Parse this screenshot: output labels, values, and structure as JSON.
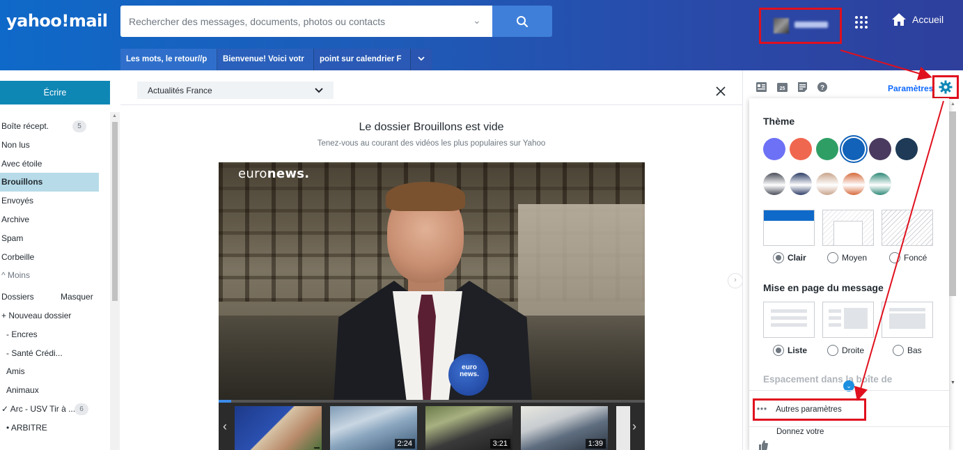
{
  "header": {
    "logo": "yahoo!mail",
    "search_placeholder": "Rechercher des messages, documents, photos ou contacts",
    "home_label": "Accueil"
  },
  "tabs": [
    {
      "label": "Les mots, le retour//p"
    },
    {
      "label": "Bienvenue! Voici votr"
    },
    {
      "label": "point sur calendrier F"
    }
  ],
  "sidebar": {
    "compose_label": "Écrire",
    "folders": [
      {
        "label": "Boîte récept.",
        "count": "5"
      },
      {
        "label": "Non lus"
      },
      {
        "label": "Avec étoile"
      },
      {
        "label": "Brouillons"
      },
      {
        "label": "Envoyés"
      },
      {
        "label": "Archive"
      },
      {
        "label": "Spam"
      },
      {
        "label": "Corbeille"
      },
      {
        "label": "^ Moins"
      }
    ],
    "folders_heading": "Dossiers",
    "hide_label": "Masquer",
    "new_folder_label": "+ Nouveau dossier",
    "user_folders": [
      {
        "label": "- Encres"
      },
      {
        "label": "- Santé Crédi..."
      },
      {
        "label": "Amis"
      },
      {
        "label": "Animaux"
      },
      {
        "label": "✓ Arc - USV Tir à ...",
        "count": "6"
      },
      {
        "label": "• ARBITRE"
      }
    ]
  },
  "main": {
    "news_select": "Actualités France",
    "empty_title": "Le dossier Brouillons est vide",
    "empty_subtitle": "Tenez-vous au courant des vidéos les plus populaires sur Yahoo",
    "video_brand_light": "euro",
    "video_brand_bold": "news.",
    "mic_label": "euro news.",
    "progress": 0.03,
    "thumbnails": [
      {
        "duration": ""
      },
      {
        "duration": "2:24"
      },
      {
        "duration": "3:21"
      },
      {
        "duration": "1:39"
      }
    ]
  },
  "right": {
    "settings_label": "Paramètres",
    "calendar_day": "25",
    "theme_heading": "Thème",
    "theme_colors": [
      "#6d71f5",
      "#f0674f",
      "#2f9e65",
      "#1162b8",
      "#4a3a5f",
      "#1e3a56"
    ],
    "theme_images": [
      "#4b4e5a",
      "#2d3e66",
      "#c9a48c",
      "#d66a3c",
      "#2f8a78"
    ],
    "appearance_options": [
      {
        "label": "Clair",
        "selected": true
      },
      {
        "label": "Moyen",
        "selected": false
      },
      {
        "label": "Foncé",
        "selected": false
      }
    ],
    "layout_heading": "Mise en page du message",
    "layout_options": [
      {
        "label": "Liste",
        "selected": true
      },
      {
        "label": "Droite",
        "selected": false
      },
      {
        "label": "Bas",
        "selected": false
      }
    ],
    "spacing_heading": "Espacement dans la boîte de",
    "more_settings": "Autres paramètres",
    "feedback": "Donnez votre"
  },
  "colors": {
    "accent": "#0f69ff",
    "compose": "#0f87b5",
    "annotation_red": "#e0101e"
  }
}
